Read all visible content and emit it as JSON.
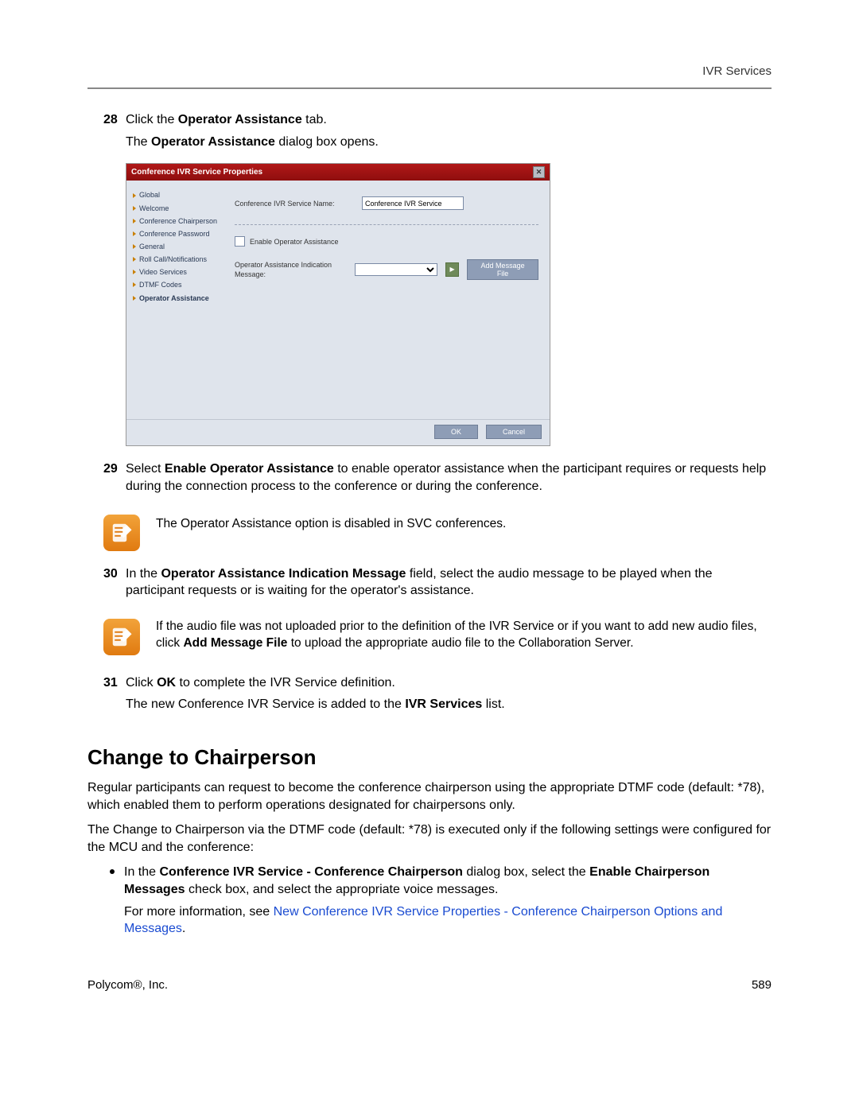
{
  "header": {
    "running": "IVR Services"
  },
  "steps": {
    "s28": {
      "num": "28",
      "line1_a": "Click the ",
      "line1_b": "Operator Assistance",
      "line1_c": " tab.",
      "line2_a": "The ",
      "line2_b": "Operator Assistance",
      "line2_c": " dialog box opens."
    },
    "s29": {
      "num": "29",
      "a": "Select ",
      "b": "Enable Operator Assistance",
      "c": " to enable operator assistance when the participant requires or requests help during the connection process to the conference or during the conference."
    },
    "s30": {
      "num": "30",
      "a": "In the ",
      "b": "Operator Assistance Indication Message",
      "c": " field, select the audio message to be played when the participant requests or is waiting for the operator's assistance."
    },
    "s31": {
      "num": "31",
      "a": "Click ",
      "b": "OK",
      "c": " to complete the IVR Service definition.",
      "d": "The new Conference IVR Service is added to the ",
      "e": "IVR Services",
      "f": " list."
    }
  },
  "dialog": {
    "title": "Conference IVR Service Properties",
    "nav": {
      "n0": "Global",
      "n1": "Welcome",
      "n2": "Conference Chairperson",
      "n3": "Conference Password",
      "n4": "General",
      "n5": "Roll Call/Notifications",
      "n6": "Video Services",
      "n7": "DTMF Codes",
      "n8": "Operator Assistance"
    },
    "service_name_label": "Conference IVR Service Name:",
    "service_name_value": "Conference IVR Service",
    "enable_label": "Enable Operator Assistance",
    "msg_label": "Operator Assistance Indication Message:",
    "add_btn": "Add Message File",
    "ok": "OK",
    "cancel": "Cancel"
  },
  "note1": "The Operator Assistance option is disabled in SVC conferences.",
  "note2": {
    "a": "If the audio file was not uploaded prior to the definition of the IVR Service or if you want to add new audio files, click ",
    "b": "Add Message File",
    "c": " to upload the appropriate audio file to the Collaboration Server."
  },
  "section": {
    "title": "Change to Chairperson",
    "p1": "Regular participants can request to become the conference chairperson using the appropriate DTMF code (default: *78), which enabled them to perform operations designated for chairpersons only.",
    "p2": "The Change to Chairperson via the DTMF code (default: *78) is executed only if the following settings were configured for the MCU and the conference:",
    "b1": {
      "a": "In the ",
      "b": "Conference IVR Service - Conference Chairperson",
      "c": " dialog box, select the ",
      "d": "Enable Chairperson Messages",
      "e": " check box, and select the appropriate voice messages.",
      "f": "For more information, see ",
      "link": "New Conference IVR Service Properties - Conference Chairperson Options and Messages",
      "g": "."
    }
  },
  "footer": {
    "left": "Polycom®, Inc.",
    "right": "589"
  }
}
